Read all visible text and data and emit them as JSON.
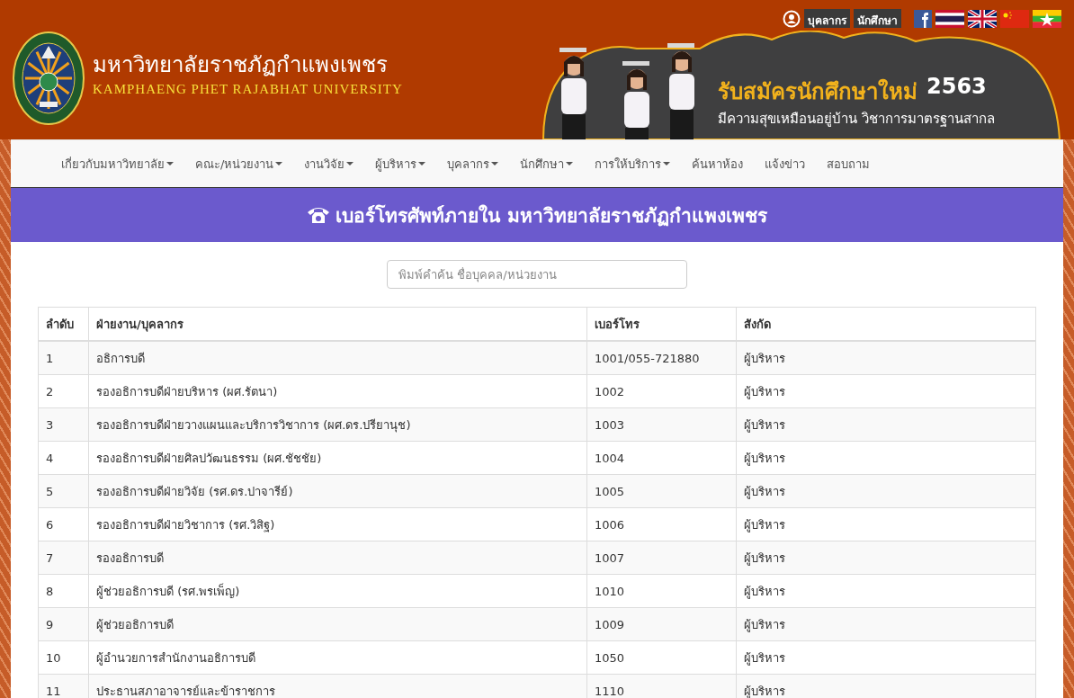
{
  "top_links": [
    {
      "label": "บุคลากร"
    },
    {
      "label": "นักศึกษา"
    }
  ],
  "university": {
    "name_th": "มหาวิทยาลัยราชภัฏกำแพงเพชร",
    "name_en": "KAMPHAENG PHET RAJABHAT UNIVERSITY"
  },
  "banner": {
    "headline": "รับสมัครนักศึกษาใหม่",
    "year": "2563",
    "slogan": "มีความสุขเหมือนอยู่บ้าน วิชาการมาตรฐานสากล"
  },
  "nav": [
    {
      "label": "เกี่ยวกับมหาวิทยาลัย",
      "dropdown": true
    },
    {
      "label": "คณะ/หน่วยงาน",
      "dropdown": true
    },
    {
      "label": "งานวิจัย",
      "dropdown": true
    },
    {
      "label": "ผู้บริหาร",
      "dropdown": true
    },
    {
      "label": "บุคลากร",
      "dropdown": true
    },
    {
      "label": "นักศึกษา",
      "dropdown": true
    },
    {
      "label": "การให้บริการ",
      "dropdown": true
    },
    {
      "label": "ค้นหาห้อง",
      "dropdown": false
    },
    {
      "label": "แจ้งข่าว",
      "dropdown": false
    },
    {
      "label": "สอบถาม",
      "dropdown": false
    }
  ],
  "page_title": "เบอร์โทรศัพท์ภายใน มหาวิทยาลัยราชภัฏกำแพงเพชร",
  "search": {
    "placeholder": "พิมพ์คำค้น ชื่อบุคคล/หน่วยงาน"
  },
  "table": {
    "columns": [
      "ลำดับ",
      "ฝ่ายงาน/บุคลากร",
      "เบอร์โทร",
      "สังกัด"
    ],
    "rows": [
      [
        "1",
        "อธิการบดี",
        "1001/055-721880",
        "ผู้บริหาร"
      ],
      [
        "2",
        "รองอธิการบดีฝ่ายบริหาร (ผศ.รัตนา)",
        "1002",
        "ผู้บริหาร"
      ],
      [
        "3",
        "รองอธิการบดีฝ่ายวางแผนและบริการวิชาการ  (ผศ.ดร.ปรียานุช)",
        "1003",
        "ผู้บริหาร"
      ],
      [
        "4",
        "รองอธิการบดีฝ่ายศิลปวัฒนธรรม (ผศ.ชัชชัย)",
        "1004",
        "ผู้บริหาร"
      ],
      [
        "5",
        "รองอธิการบดีฝ่ายวิจัย (รศ.ดร.ปาจารีย์)",
        "1005",
        "ผู้บริหาร"
      ],
      [
        "6",
        "รองอธิการบดีฝ่ายวิชาการ (รศ.วิสิฐ)",
        "1006",
        "ผู้บริหาร"
      ],
      [
        "7",
        "รองอธิการบดี",
        "1007",
        "ผู้บริหาร"
      ],
      [
        "8",
        "ผู้ช่วยอธิการบดี (รศ.พรเพ็ญ)",
        "1010",
        "ผู้บริหาร"
      ],
      [
        "9",
        "ผู้ช่วยอธิการบดี",
        "1009",
        "ผู้บริหาร"
      ],
      [
        "10",
        "ผู้อำนวยการสำนักงานอธิการบดี",
        "1050",
        "ผู้บริหาร"
      ],
      [
        "11",
        "ประธานสภาอาจารย์และข้าราชการ",
        "1110",
        "ผู้บริหาร"
      ]
    ]
  }
}
